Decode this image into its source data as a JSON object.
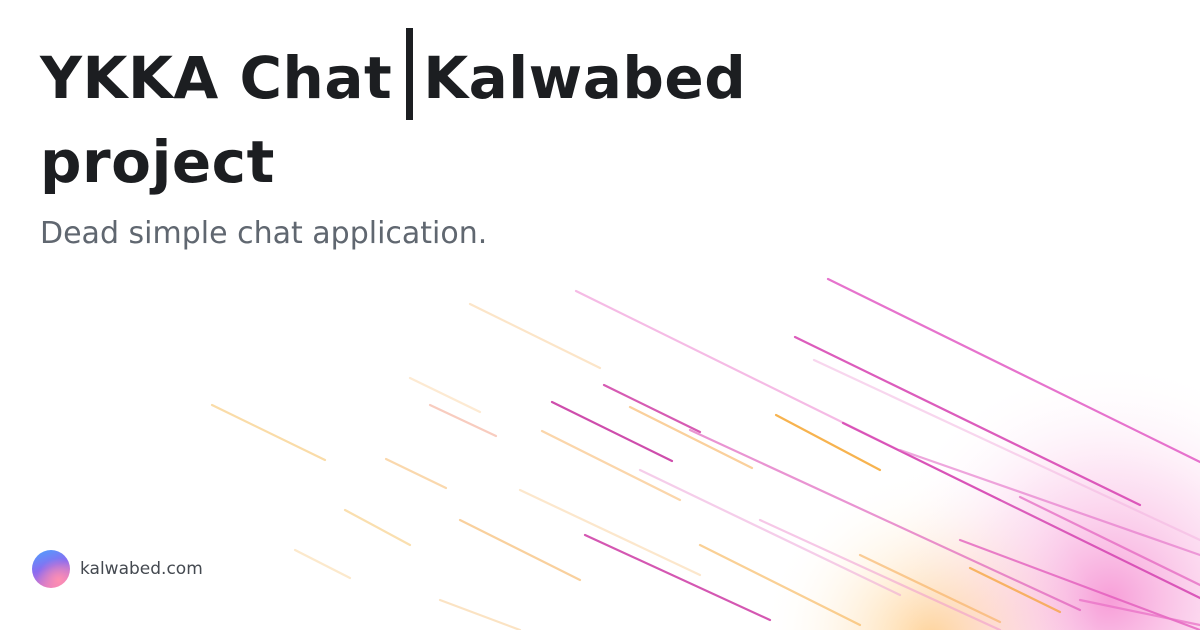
{
  "title": {
    "part1": "YKKA Chat",
    "part2": "Kalwabed project"
  },
  "subtitle": "Dead simple chat application.",
  "brand": {
    "domain": "kalwabed.com"
  },
  "colors": {
    "title": "#1c1e21",
    "subtitle": "#606770",
    "accent_pink": "#e040b8",
    "accent_orange": "#f5a023"
  }
}
